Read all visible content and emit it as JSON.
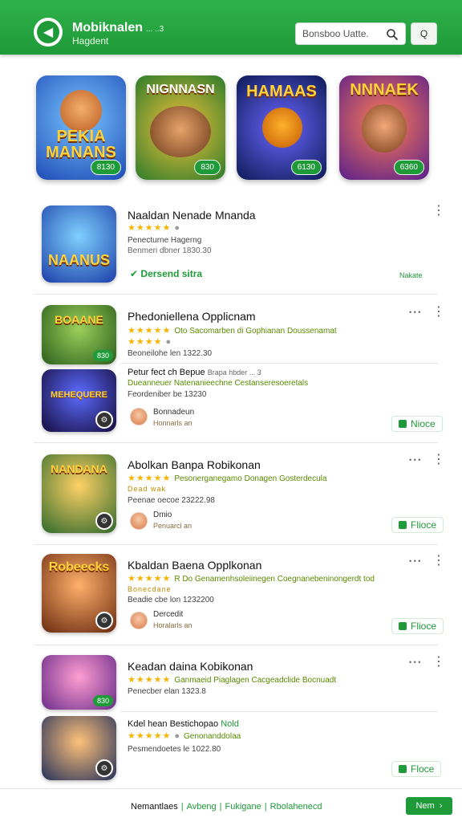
{
  "header": {
    "title": "Mobiknalen",
    "title_small": "... ..3",
    "subtitle": "Hagdent",
    "search_placeholder": "Bonsboo Uatte.",
    "button_label": "Q"
  },
  "featured": [
    {
      "title": "PEKIA MANANS",
      "badge": "8130",
      "icon": "fox-character"
    },
    {
      "title": "NIGNNASN",
      "badge": "830",
      "icon": "warriors-group"
    },
    {
      "title": "HAMAAS",
      "badge": "6130",
      "icon": "pumpkin-character"
    },
    {
      "title": "NNNAEK",
      "badge": "6360",
      "icon": "dwarf-character"
    }
  ],
  "rows": [
    {
      "name": "Naaldan Nenade Mnanda",
      "stars": "★★★★★",
      "meta": "Penecturne Hagerng",
      "meta2": "Benmeri dbner 1830.30",
      "install": "Dersend sitra",
      "right_small": "Nakate",
      "thumb_title": "NAANUS"
    },
    {
      "name": "Phedoniellena Opplicnam",
      "stars": "★★★★★",
      "tag": "Oto Sacomarben di Gophianan Doussenamat",
      "stars2": "★★★★",
      "meta": "Beoneilohe len 1322.30",
      "right_small": "• • •",
      "thumb_title": "BOAANE",
      "thumb_badge": "830"
    },
    {
      "name": "Petur fect ch Bepue",
      "name_small": "Brapa hbder ... 3",
      "tag": "Dueanneuer Natenanieechne Cestanseresoeretals",
      "meta": "Feordeniber be 13230",
      "dev": "Bonnadeun",
      "dev2": "Honnarls an",
      "button": "Nioce",
      "thumb_title": "MEHEQUERE"
    },
    {
      "name": "Abolkan Banpa Robikonan",
      "tag": "Pesonerganegamo Donagen Gosterdecula",
      "stars2": "Dead wak",
      "meta": "Peenae oecoe 23222.98",
      "dev": "Dmio",
      "dev2": "Penuarcl an",
      "button": "Flioce",
      "right_small": "• • •",
      "thumb_title": "NANDANA"
    },
    {
      "name": "Kbaldan Baena Opplkonan",
      "tag": "R Do Genamenhsoleiinegen Coegnanebeninongerdt tod",
      "stars2": "Bonecdane",
      "meta": "Beadie cbe lon 1232200",
      "dev": "Dercedit",
      "dev2": "Horalarls an",
      "button": "Flioce",
      "right_small": "• • •",
      "thumb_title": "Robeecks"
    },
    {
      "name": "Keadan daina Kobikonan",
      "tag": "Ganmaeid Piaglagen Cacgeadclide Bocnuadt",
      "meta": "Penecber elan 1323.8",
      "right_small": "• • •",
      "thumb_badge": "830"
    },
    {
      "name": "Kdel hean Bestichopao",
      "name_tag": "Nold",
      "tag": "Genonanddolaa",
      "meta": "Pesmendoetes le 1022.80",
      "button": "Floce"
    }
  ],
  "footer": {
    "link1": "Nemantlaes",
    "link2": "Avbeng",
    "link3": "Fukigane",
    "link4": "Rbolahenecd",
    "button": "Nem"
  },
  "colors": {
    "brand_green": "#1f9a39",
    "star_yellow": "#f5b400"
  }
}
